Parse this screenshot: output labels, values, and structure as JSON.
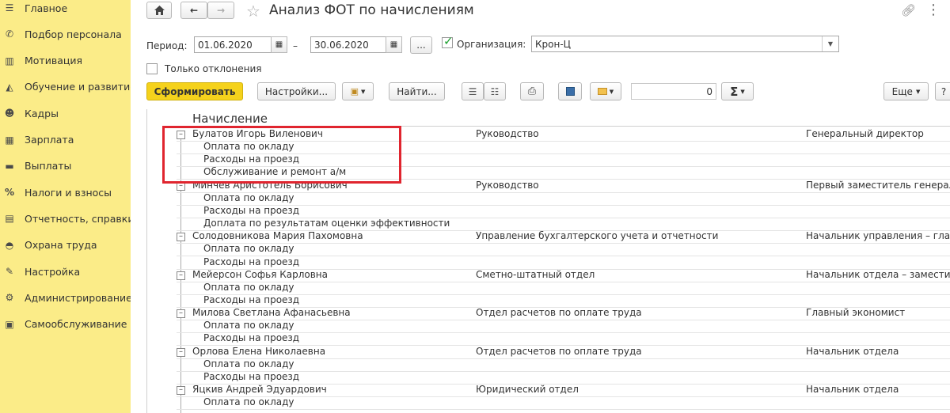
{
  "sidebar": {
    "items": [
      {
        "label": "Главное",
        "icon": "menu-icon"
      },
      {
        "label": "Подбор персонала",
        "icon": "phone-icon"
      },
      {
        "label": "Мотивация",
        "icon": "gift-icon"
      },
      {
        "label": "Обучение и развитие",
        "icon": "graduation-cap-icon"
      },
      {
        "label": "Кадры",
        "icon": "people-icon"
      },
      {
        "label": "Зарплата",
        "icon": "calculator-icon"
      },
      {
        "label": "Выплаты",
        "icon": "wallet-icon"
      },
      {
        "label": "Налоги и взносы",
        "icon": "percent-icon"
      },
      {
        "label": "Отчетность, справки",
        "icon": "report-icon"
      },
      {
        "label": "Охрана труда",
        "icon": "helmet-icon"
      },
      {
        "label": "Настройка",
        "icon": "wrench-icon"
      },
      {
        "label": "Администрирование",
        "icon": "gear-icon"
      },
      {
        "label": "Самообслуживание",
        "icon": "id-card-icon"
      }
    ]
  },
  "header": {
    "title": "Анализ ФОТ по начислениям"
  },
  "filters": {
    "period_label": "Период:",
    "date_from": "01.06.2020",
    "dash": "–",
    "date_to": "30.06.2020",
    "ellipsis": "...",
    "org_label": "Организация:",
    "org_value": "Крон-Ц",
    "only_deviations_label": "Только отклонения"
  },
  "toolbar": {
    "generate": "Сформировать",
    "settings": "Настройки...",
    "find": "Найти...",
    "sum_value": "0",
    "sigma": "Σ",
    "more": "Еще",
    "help": "?"
  },
  "table": {
    "header": "Начисление",
    "rows": [
      {
        "type": "employee",
        "name": "Булатов Игорь Виленович",
        "dept": "Руководство",
        "position": "Генеральный директор"
      },
      {
        "type": "charge",
        "name": "Оплата по окладу"
      },
      {
        "type": "charge",
        "name": "Расходы на проезд"
      },
      {
        "type": "charge",
        "name": "Обслуживание и ремонт а/м"
      },
      {
        "type": "employee",
        "name": "Минчев Аристотель Борисович",
        "dept": "Руководство",
        "position": "Первый заместитель генеральн"
      },
      {
        "type": "charge",
        "name": "Оплата по окладу"
      },
      {
        "type": "charge",
        "name": "Расходы на проезд"
      },
      {
        "type": "charge",
        "name": "Доплата по результатам оценки эффективности"
      },
      {
        "type": "employee",
        "name": "Солодовникова Мария Пахомовна",
        "dept": "Управление бухгалтерского учета и отчетности",
        "position": "Начальник управления – главн"
      },
      {
        "type": "charge",
        "name": "Оплата по окладу"
      },
      {
        "type": "charge",
        "name": "Расходы на проезд"
      },
      {
        "type": "employee",
        "name": "Мейерсон Софья Карловна",
        "dept": "Сметно-штатный отдел",
        "position": "Начальник отдела – заместите."
      },
      {
        "type": "charge",
        "name": "Оплата по окладу"
      },
      {
        "type": "charge",
        "name": "Расходы на проезд"
      },
      {
        "type": "employee",
        "name": "Милова Светлана Афанасьевна",
        "dept": "Отдел расчетов по оплате труда",
        "position": "Главный экономист"
      },
      {
        "type": "charge",
        "name": "Оплата по окладу"
      },
      {
        "type": "charge",
        "name": "Расходы на проезд"
      },
      {
        "type": "employee",
        "name": "Орлова Елена Николаевна",
        "dept": "Отдел расчетов по оплате труда",
        "position": "Начальник отдела"
      },
      {
        "type": "charge",
        "name": "Оплата по окладу"
      },
      {
        "type": "charge",
        "name": "Расходы на проезд"
      },
      {
        "type": "employee",
        "name": "Яцкив Андрей Эдуардович",
        "dept": "Юридический отдел",
        "position": "Начальник отдела"
      },
      {
        "type": "charge",
        "name": "Оплата по окладу"
      }
    ]
  },
  "colors": {
    "sidebar_bg": "#fbec88",
    "generate_button": "#f5d21c",
    "highlight_border": "#e0252f"
  }
}
